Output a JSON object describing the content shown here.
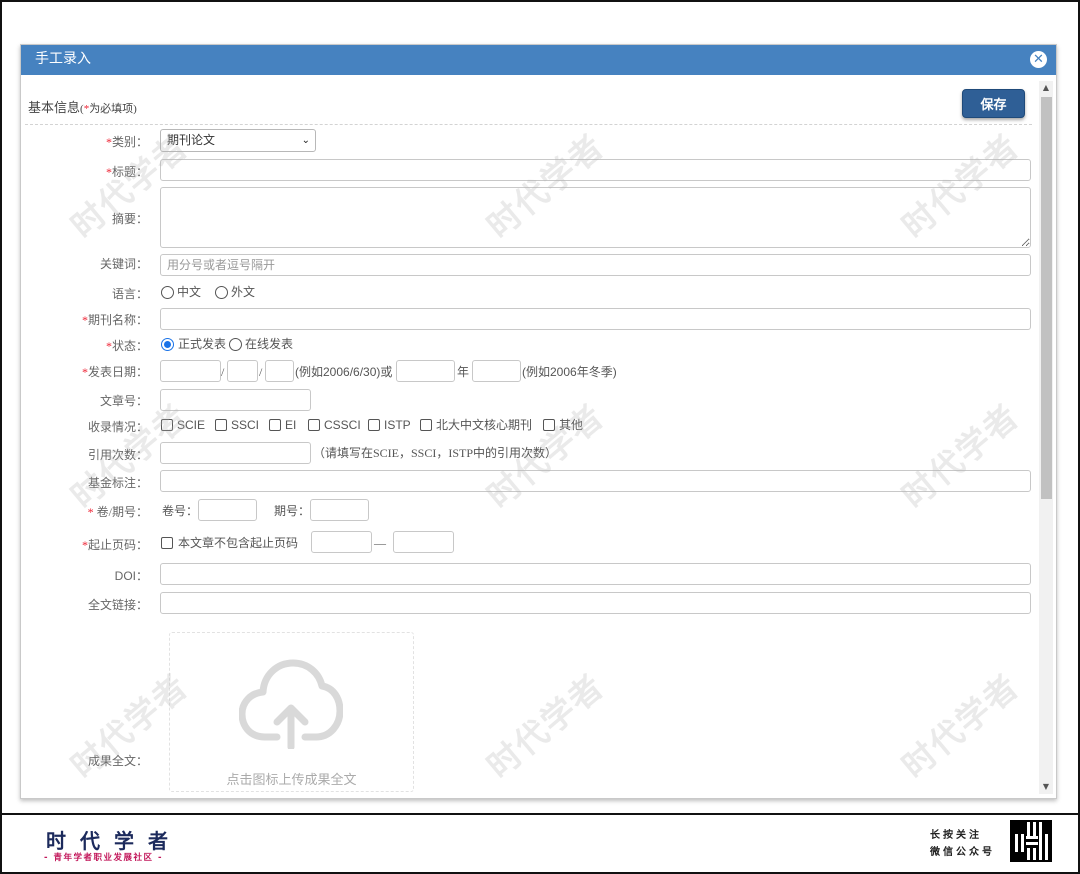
{
  "dialog": {
    "title": "手工录入",
    "section_title": "基本信息",
    "section_note_prefix": "(",
    "section_note_star": "*",
    "section_note_text": "为必填项)",
    "save_label": "保存"
  },
  "form": {
    "category_label": "类别",
    "category_value": "期刊论文",
    "title_label": "标题",
    "abstract_label": "摘要：",
    "keywords_label": "关键词：",
    "keywords_placeholder": "用分号或者逗号隔开",
    "language_label": "语言：",
    "language_options": [
      "中文",
      "外文"
    ],
    "journal_label": "期刊名称",
    "status_label": "状态",
    "status_options": [
      "正式发表",
      "在线发表"
    ],
    "pubdate_label": "发表日期",
    "date_sep": "/",
    "date_example": "(例如2006/6/30)或",
    "year_unit": "年",
    "season_example": "(例如2006年冬季)",
    "article_no_label": "文章号：",
    "indexing_label": "收录情况：",
    "indexing_options": [
      "SCIE",
      "SSCI",
      "EI",
      "CSSCI",
      "ISTP",
      "北大中文核心期刊",
      "其他"
    ],
    "citations_label": "引用次数：",
    "citations_hint": "（请填写在SCIE，SSCI，ISTP中的引用次数）",
    "fund_label": "基金标注：",
    "volume_issue_label": "卷/期号",
    "volume_label": "卷号：",
    "issue_label": "期号：",
    "pages_label": "起止页码",
    "no_pages_label": "本文章不包含起止页码",
    "pages_dash": "—",
    "doi_label": "DOI：",
    "fulltext_link_label": "全文链接：",
    "fulltext_label": "成果全文：",
    "upload_hint": "点击图标上传成果全文",
    "colon": "："
  },
  "watermark": "时代学者",
  "footer": {
    "brand": "时代学者",
    "slogan": "- 青年学者职业发展社区 -",
    "follow_line1": "长按关注",
    "follow_line2": "微信公众号"
  },
  "colors": {
    "header_bg": "#4682c0",
    "save_bg": "#2f5f96",
    "required": "#e23"
  },
  "icons": [
    "close-icon",
    "chevron-down-icon",
    "cloud-upload-icon",
    "scroll-up-icon",
    "scroll-down-icon",
    "qr-code-icon"
  ]
}
